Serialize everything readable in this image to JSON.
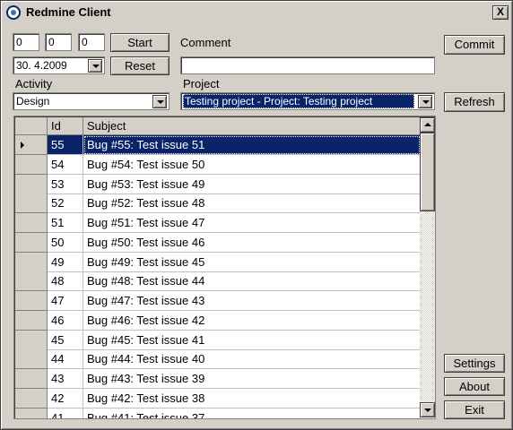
{
  "window": {
    "title": "Redmine Client",
    "close_label": "X"
  },
  "timer": {
    "hours": "0",
    "minutes": "0",
    "seconds": "0",
    "start_label": "Start",
    "reset_label": "Reset"
  },
  "date": {
    "value": "30.  4.2009"
  },
  "comment": {
    "label": "Comment",
    "value": ""
  },
  "activity": {
    "label": "Activity",
    "selected": "Design"
  },
  "project": {
    "label": "Project",
    "selected": "Testing project - Project: Testing project"
  },
  "buttons": {
    "commit": "Commit",
    "refresh": "Refresh",
    "settings": "Settings",
    "about": "About",
    "exit": "Exit"
  },
  "grid": {
    "columns": [
      "Id",
      "Subject"
    ],
    "selected_row": 0,
    "rows": [
      {
        "id": "55",
        "subject": "Bug #55: Test issue 51"
      },
      {
        "id": "54",
        "subject": "Bug #54: Test issue 50"
      },
      {
        "id": "53",
        "subject": "Bug #53: Test issue 49"
      },
      {
        "id": "52",
        "subject": "Bug #52: Test issue 48"
      },
      {
        "id": "51",
        "subject": "Bug #51: Test issue 47"
      },
      {
        "id": "50",
        "subject": "Bug #50: Test issue 46"
      },
      {
        "id": "49",
        "subject": "Bug #49: Test issue 45"
      },
      {
        "id": "48",
        "subject": "Bug #48: Test issue 44"
      },
      {
        "id": "47",
        "subject": "Bug #47: Test issue 43"
      },
      {
        "id": "46",
        "subject": "Bug #46: Test issue 42"
      },
      {
        "id": "45",
        "subject": "Bug #45: Test issue 41"
      },
      {
        "id": "44",
        "subject": "Bug #44: Test issue 40"
      },
      {
        "id": "43",
        "subject": "Bug #43: Test issue 39"
      },
      {
        "id": "42",
        "subject": "Bug #42: Test issue 38"
      },
      {
        "id": "41",
        "subject": "Bug #41: Test issue 37"
      }
    ]
  },
  "colors": {
    "selection": "#0a246a",
    "face": "#d4d0c8"
  }
}
